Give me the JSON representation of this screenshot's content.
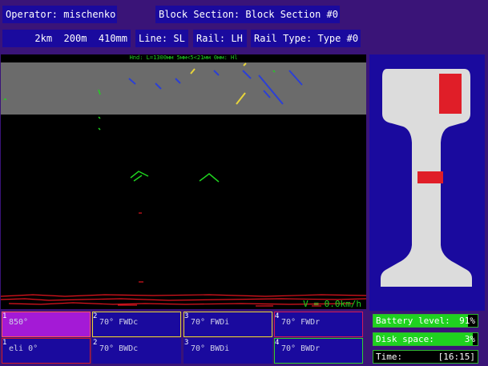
{
  "header": {
    "operator_label": "Operator:",
    "operator_value": "mischenko",
    "block_label": "Block Section:",
    "block_value": "Block Section #0"
  },
  "position": {
    "km": "2km",
    "m": "200m",
    "mm": "410mm"
  },
  "line": {
    "label": "Line:",
    "value": "SL"
  },
  "rail": {
    "label": "Rail:",
    "value": "LH"
  },
  "rail_type": {
    "label": "Rail Type:",
    "value": "Type #0"
  },
  "scan": {
    "header_text": "Hnd: L=1300мм 5мм<5<21мм 0мм: Hl",
    "speed_text": "V = 0.0km/h"
  },
  "channels": [
    {
      "num": "1",
      "label": "850°",
      "color": "#a41ad6",
      "border": "#ff5555",
      "active": true
    },
    {
      "num": "2",
      "label": "70° FWDc",
      "color": "#1a0a9e",
      "border": "#e8d53a",
      "active": false
    },
    {
      "num": "3",
      "label": "70° FWDi",
      "color": "#1a0a9e",
      "border": "#e8d53a",
      "active": false
    },
    {
      "num": "4",
      "label": "70° FWDr",
      "color": "#1a0a9e",
      "border": "#d21a5a",
      "active": false
    },
    {
      "num": "1",
      "label": "eli 0°",
      "color": "#1a0a9e",
      "border": "#d21a2a",
      "active": false
    },
    {
      "num": "2",
      "label": "70° BWDc",
      "color": "#1a0a9e",
      "border": "#1a0a9e",
      "active": false
    },
    {
      "num": "3",
      "label": "70° BWDi",
      "color": "#1a0a9e",
      "border": "#1a0a9e",
      "active": false
    },
    {
      "num": "4",
      "label": "70° BWDr",
      "color": "#1a0a9e",
      "border": "#2fd22f",
      "active": false
    }
  ],
  "status": {
    "battery_label": "Battery level:",
    "battery_value": "91%",
    "battery_fraction": 0.91,
    "disk_label": "Disk space:",
    "disk_value": "3%",
    "disk_fraction": 0.95,
    "time_label": "Time:",
    "time_value": "[16:15]"
  },
  "colors": {
    "panel": "#1a0a9e",
    "background": "#3a1478",
    "rail_profile": "#dcdcdc",
    "defect": "#e01e28",
    "green": "#1fd21f",
    "blue_marks": "#2b3fd6",
    "red_marks": "#e0141e"
  }
}
